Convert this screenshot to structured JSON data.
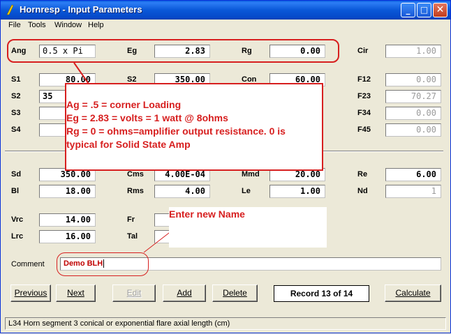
{
  "window": {
    "title": "Hornresp - Input Parameters"
  },
  "menu": [
    "File",
    "Tools",
    "Window",
    "Help"
  ],
  "row_top": {
    "ang_label": "Ang",
    "ang_value": "0.5 x Pi",
    "eg_label": "Eg",
    "eg_value": "2.83",
    "rg_label": "Rg",
    "rg_value": "0.00",
    "cir_label": "Cir",
    "cir_value": "1.00"
  },
  "horn": {
    "s1_label": "S1",
    "s1_value": "80.00",
    "s2_label": "S2",
    "s2_value": "35",
    "s3_label": "S3",
    "s3_value": "",
    "s4_label": "S4",
    "s4_value": "",
    "s2b_label": "S2",
    "s2b_value": "350.00",
    "con_label": "Con",
    "con_value": "60.00",
    "f12_label": "F12",
    "f12_value": "0.00",
    "f23_label": "F23",
    "f23_value": "70.27",
    "f34_label": "F34",
    "f34_value": "0.00",
    "f45_label": "F45",
    "f45_value": "0.00"
  },
  "driver": {
    "sd_label": "Sd",
    "sd_value": "350.00",
    "cms_label": "Cms",
    "cms_value": "4.00E-04",
    "mmd_label": "Mmd",
    "mmd_value": "20.00",
    "re_label": "Re",
    "re_value": "6.00",
    "bl_label": "Bl",
    "bl_value": "18.00",
    "rms_label": "Rms",
    "rms_value": "4.00",
    "le_label": "Le",
    "le_value": "1.00",
    "nd_label": "Nd",
    "nd_value": "1"
  },
  "chamber": {
    "vrc_label": "Vrc",
    "vrc_value": "14.00",
    "lrc_label": "Lrc",
    "lrc_value": "16.00",
    "fr_label": "Fr",
    "tal_label": "Tal"
  },
  "comment": {
    "label": "Comment",
    "value": "Demo BLH"
  },
  "buttons": {
    "previous": "Previous",
    "next": "Next",
    "edit": "Edit",
    "add": "Add",
    "delete": "Delete",
    "calculate": "Calculate"
  },
  "record": "Record 13 of 14",
  "status": "L34   Horn segment 3 conical or exponential flare axial length  (cm)",
  "annotations": {
    "line1": "Ag = .5 = corner Loading",
    "line2": "Eg = 2.83 = volts = 1 watt @ 8ohms",
    "line3": "Rg = 0 = ohms=amplifier output resistance. 0 is",
    "line4": "typical for Solid State Amp",
    "name_hint": "Enter new Name"
  },
  "colors": {
    "annotation": "#d71f1f",
    "titlebar": "#0a58d8"
  }
}
